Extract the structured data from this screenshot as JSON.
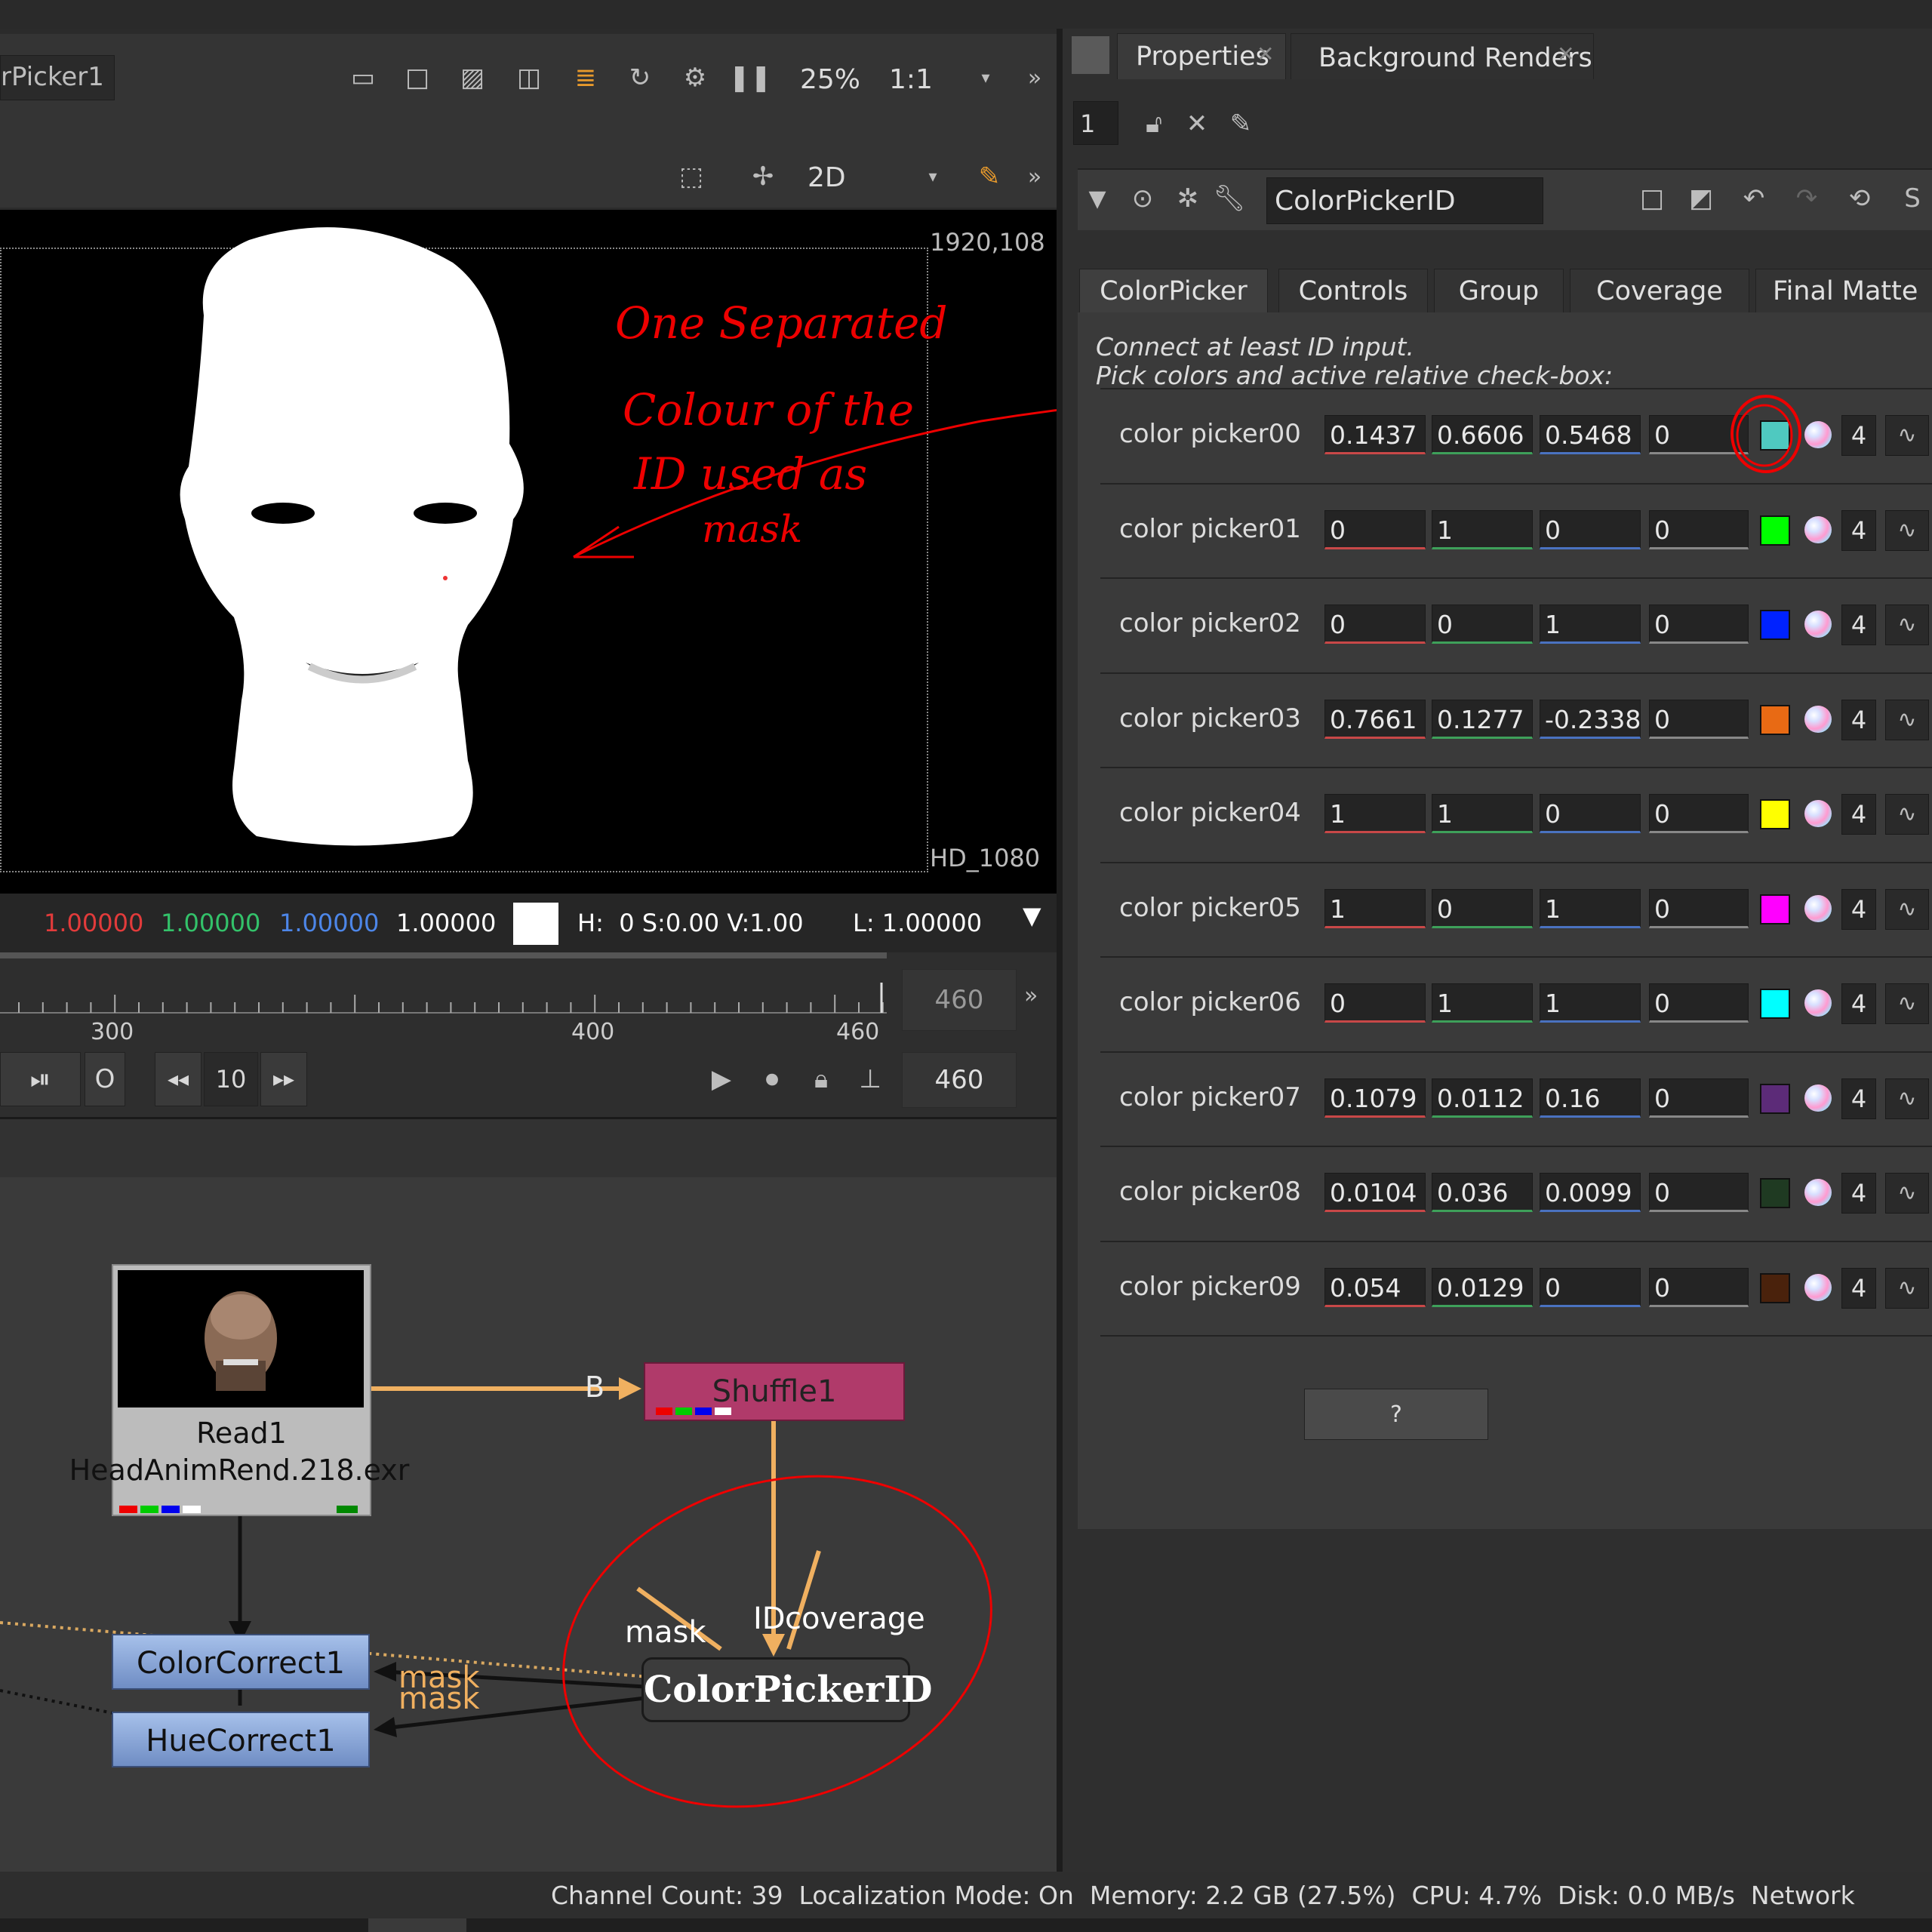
{
  "viewer": {
    "node_name_partial": "rPicker1",
    "zoom": "25%",
    "ratio": "1:1",
    "view_mode": "2D",
    "format_resolution": "1920,108",
    "format_name": "HD_1080",
    "annotation_lines": [
      "One Separated",
      "Colour of the",
      "ID used as",
      "mask"
    ]
  },
  "pixel_info": {
    "r": "1.00000",
    "g": "1.00000",
    "b": "1.00000",
    "a": "1.00000",
    "hsv": "H:  0 S:0.00 V:1.00",
    "luminance": "L: 1.00000",
    "colors": {
      "r": "#e23b3b",
      "g": "#33c26a",
      "b": "#4d86e8",
      "a": "#ffffff"
    }
  },
  "timeline": {
    "ticks": [
      "300",
      "400",
      "460"
    ],
    "current_frame": "460",
    "end_frame": "460",
    "step": "10"
  },
  "properties_panel": {
    "tabs": [
      {
        "label": "Properties",
        "close": "✕"
      },
      {
        "label": "Background Renders",
        "close": "✕"
      }
    ],
    "max_panels": "1",
    "node_name": "ColorPickerID",
    "node_tabs": [
      "ColorPicker",
      "Controls",
      "Group",
      "Coverage",
      "Final Matte"
    ],
    "help_line1": "Connect at least ID input.",
    "help_line2": "Pick colors and active relative check-box:",
    "pickers": [
      {
        "label": "color picker00",
        "r": "0.1437",
        "g": "0.6606",
        "b": "0.5468",
        "a": "0",
        "swatch": "#4fc9c0",
        "channels": "4"
      },
      {
        "label": "color picker01",
        "r": "0",
        "g": "1",
        "b": "0",
        "a": "0",
        "swatch": "#00ff00",
        "channels": "4"
      },
      {
        "label": "color picker02",
        "r": "0",
        "g": "0",
        "b": "1",
        "a": "0",
        "swatch": "#0022ff",
        "channels": "4"
      },
      {
        "label": "color picker03",
        "r": "0.7661",
        "g": "0.1277",
        "b": "-0.2338",
        "a": "0",
        "swatch": "#e86a14",
        "channels": "4"
      },
      {
        "label": "color picker04",
        "r": "1",
        "g": "1",
        "b": "0",
        "a": "0",
        "swatch": "#ffff00",
        "channels": "4"
      },
      {
        "label": "color picker05",
        "r": "1",
        "g": "0",
        "b": "1",
        "a": "0",
        "swatch": "#ff00ff",
        "channels": "4"
      },
      {
        "label": "color picker06",
        "r": "0",
        "g": "1",
        "b": "1",
        "a": "0",
        "swatch": "#00ffff",
        "channels": "4"
      },
      {
        "label": "color picker07",
        "r": "0.1079",
        "g": "0.0112",
        "b": "0.16",
        "a": "0",
        "swatch": "#5c2b78",
        "channels": "4"
      },
      {
        "label": "color picker08",
        "r": "0.0104",
        "g": "0.036",
        "b": "0.0099",
        "a": "0",
        "swatch": "#1f3a22",
        "channels": "4"
      },
      {
        "label": "color picker09",
        "r": "0.054",
        "g": "0.0129",
        "b": "0",
        "a": "0",
        "swatch": "#4a220c",
        "channels": "4"
      }
    ],
    "help_button": "?"
  },
  "node_graph": {
    "read_node": {
      "name": "Read1",
      "file": "HeadAnimRend.218.exr"
    },
    "shuffle_node": {
      "name": "Shuffle1",
      "input": "B"
    },
    "colorcorrect_node": {
      "name": "ColorCorrect1"
    },
    "huecorrect_node": {
      "name": "HueCorrect1"
    },
    "picker_node": {
      "name": "ColorPickerID",
      "inputs": [
        "mask",
        "ID",
        "coverage"
      ]
    },
    "mask_labels": [
      "mask",
      "mask"
    ]
  },
  "status_bar": {
    "text": "Channel Count: 39  Localization Mode: On  Memory: 2.2 GB (27.5%)  CPU: 4.7%  Disk: 0.0 MB/s  Network"
  }
}
